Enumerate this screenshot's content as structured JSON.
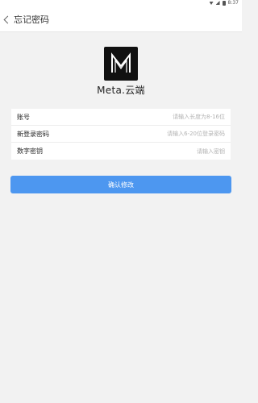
{
  "status_bar": {
    "time": "8:37"
  },
  "nav": {
    "title": "忘记密码"
  },
  "brand": {
    "name": "Meta.云端",
    "logo_letter": "M"
  },
  "form": {
    "rows": [
      {
        "label": "账号",
        "placeholder": "请输入长度为8-16位",
        "value": ""
      },
      {
        "label": "新登录密码",
        "placeholder": "请输入6-20位登录密码",
        "value": ""
      },
      {
        "label": "数字密钥",
        "placeholder": "请输入密钥",
        "value": ""
      }
    ]
  },
  "confirm_button": {
    "label": "确认修改"
  },
  "colors": {
    "accent": "#4d97f0",
    "background": "#f2f2f2"
  }
}
